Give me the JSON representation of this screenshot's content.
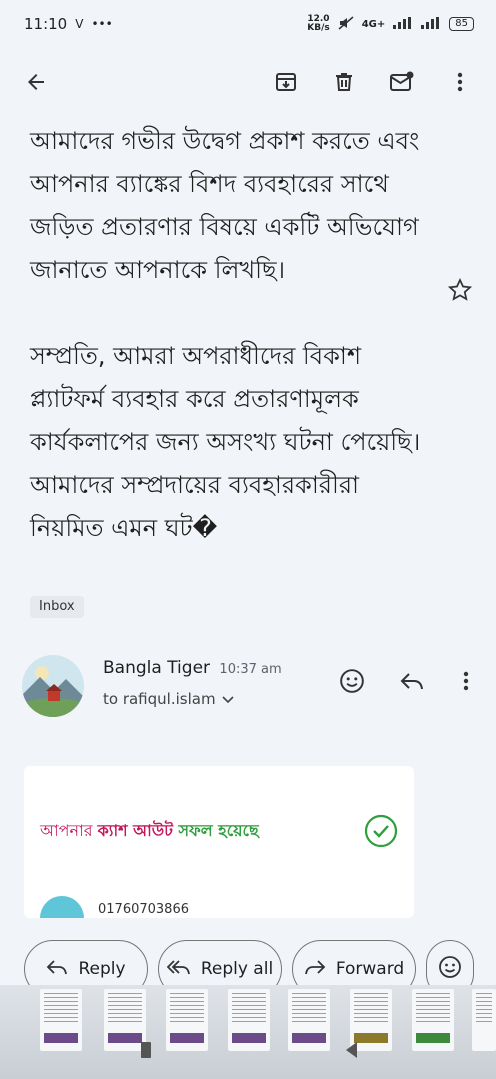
{
  "status_bar": {
    "time": "11:10",
    "net_speed_top": "12.0",
    "net_speed_bottom": "KB/s",
    "network": "4G+",
    "battery": "85"
  },
  "toolbar": {
    "back_icon": "arrow-left-icon",
    "archive_icon": "archive-icon",
    "delete_icon": "trash-icon",
    "mark_unread_icon": "mail-unread-icon",
    "more_icon": "more-vert-icon"
  },
  "message": {
    "para1": "আমাদের গভীর উদ্বেগ প্রকাশ করতে এবং আপনার ব্যাঙ্কের বিশদ ব্যবহারের সাথে জড়িত প্রতারণার বিষয়ে একটি অভিযোগ জানাতে আপনাকে লিখছি।",
    "para2": "সম্প্রতি, আমরা অপরাধীদের বিকাশ প্ল্যাটফর্ম ব্যবহার করে প্রতারণামূলক কার্যকলাপের জন্য অসংখ্য ঘটনা পেয়েছি। আমাদের সম্প্রদায়ের ব্যবহারকারীরা নিয়মিত এমন ঘট�",
    "label_chip": "Inbox"
  },
  "sender": {
    "name": "Bangla Tiger",
    "time": "10:37 am",
    "recipient": "to rafiqul.islam"
  },
  "attachment_card": {
    "headline_part1": "আপনার ",
    "headline_part2": "ক্যাশ আউট",
    "headline_part3": " সফল হয়েছে",
    "phone": "01760703866"
  },
  "actions": {
    "reply_label": "Reply",
    "reply_all_label": "Reply all",
    "forward_label": "Forward"
  },
  "colors": {
    "background": "#f1f4f9",
    "accent_pink": "#c2185b",
    "accent_green": "#2e9e3f"
  }
}
